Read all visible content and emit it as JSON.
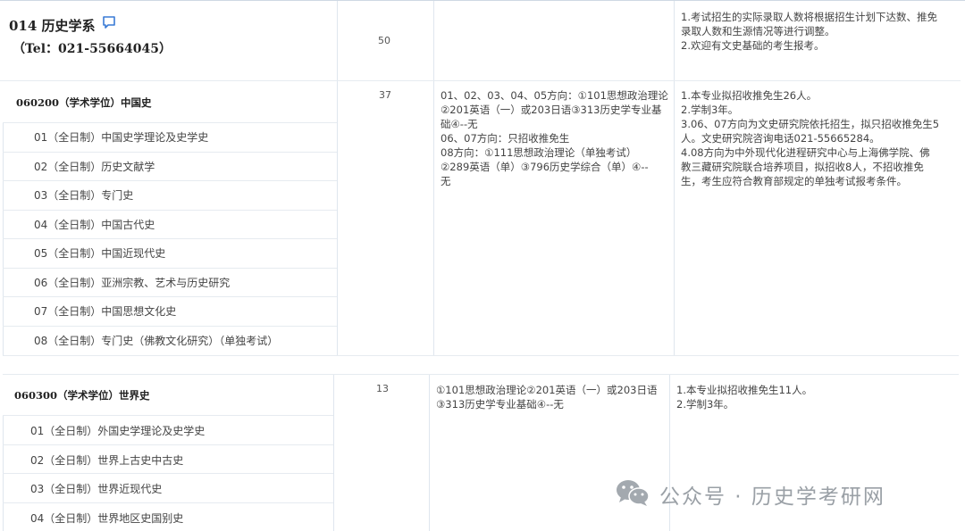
{
  "department": {
    "name": "014 历史学系",
    "tel": "（Tel：021-55664045）",
    "enrollment": "50",
    "notes": [
      "1.考试招生的实际录取人数将根据招生计划下达数、推免",
      "录取人数和生源情况等进行调整。",
      "2.欢迎有文史基础的考生报考。"
    ]
  },
  "major1": {
    "title": "060200（学术学位）中国史",
    "enrollment": "37",
    "directions": [
      "01（全日制）中国史学理论及史学史",
      "02（全日制）历史文献学",
      "03（全日制）专门史",
      "04（全日制）中国古代史",
      "05（全日制）中国近现代史",
      "06（全日制）亚洲宗教、艺术与历史研究",
      "07（全日制）中国思想文化史",
      "08（全日制）专门史（佛教文化研究）（单独考试）"
    ],
    "exams": [
      "01、02、03、04、05方向：①101思想政治理论",
      "②201英语（一）或203日语③313历史学专业基",
      "础④--无",
      "06、07方向：只招收推免生",
      "08方向：①111思想政治理论（单独考试）",
      "②289英语（单）③796历史学综合（单）④--",
      "无"
    ],
    "notes": [
      "1.本专业拟招收推免生26人。",
      "2.学制3年。",
      "3.06、07方向为文史研究院依托招生，拟只招收推免生5",
      "人。文史研究院咨询电话021-55665284。",
      "4.08方向为中外现代化进程研究中心与上海佛学院、佛",
      "教三藏研究院联合培养项目，拟招收8人，不招收推免",
      "生，考生应符合教育部规定的单独考试报考条件。"
    ]
  },
  "major2": {
    "title": "060300（学术学位）世界史",
    "enrollment": "13",
    "directions": [
      "01（全日制）外国史学理论及史学史",
      "02（全日制）世界上古史中古史",
      "03（全日制）世界近现代史",
      "04（全日制）世界地区史国别史"
    ],
    "exams": [
      "①101思想政治理论②201英语（一）或203日语",
      "③313历史学专业基础④--无"
    ],
    "notes": [
      "1.本专业拟招收推免生11人。",
      "2.学制3年。"
    ]
  },
  "watermark": {
    "text": "公众号 · 历史学考研网",
    "icon": "wechat-icon"
  },
  "colors": {
    "accent_blue": "#3a7bd5",
    "border": "#dfe6ee",
    "watermark": "#9aa0a6"
  }
}
